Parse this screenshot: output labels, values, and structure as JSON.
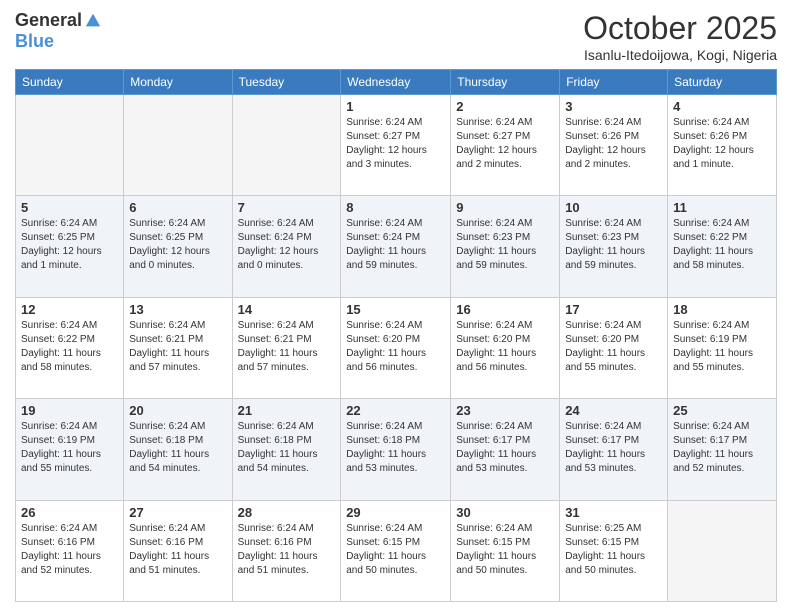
{
  "logo": {
    "general": "General",
    "blue": "Blue"
  },
  "title": "October 2025",
  "location": "Isanlu-Itedoijowa, Kogi, Nigeria",
  "days_of_week": [
    "Sunday",
    "Monday",
    "Tuesday",
    "Wednesday",
    "Thursday",
    "Friday",
    "Saturday"
  ],
  "weeks": [
    [
      {
        "day": "",
        "content": ""
      },
      {
        "day": "",
        "content": ""
      },
      {
        "day": "",
        "content": ""
      },
      {
        "day": "1",
        "content": "Sunrise: 6:24 AM\nSunset: 6:27 PM\nDaylight: 12 hours and 3 minutes."
      },
      {
        "day": "2",
        "content": "Sunrise: 6:24 AM\nSunset: 6:27 PM\nDaylight: 12 hours and 2 minutes."
      },
      {
        "day": "3",
        "content": "Sunrise: 6:24 AM\nSunset: 6:26 PM\nDaylight: 12 hours and 2 minutes."
      },
      {
        "day": "4",
        "content": "Sunrise: 6:24 AM\nSunset: 6:26 PM\nDaylight: 12 hours and 1 minute."
      }
    ],
    [
      {
        "day": "5",
        "content": "Sunrise: 6:24 AM\nSunset: 6:25 PM\nDaylight: 12 hours and 1 minute."
      },
      {
        "day": "6",
        "content": "Sunrise: 6:24 AM\nSunset: 6:25 PM\nDaylight: 12 hours and 0 minutes."
      },
      {
        "day": "7",
        "content": "Sunrise: 6:24 AM\nSunset: 6:24 PM\nDaylight: 12 hours and 0 minutes."
      },
      {
        "day": "8",
        "content": "Sunrise: 6:24 AM\nSunset: 6:24 PM\nDaylight: 11 hours and 59 minutes."
      },
      {
        "day": "9",
        "content": "Sunrise: 6:24 AM\nSunset: 6:23 PM\nDaylight: 11 hours and 59 minutes."
      },
      {
        "day": "10",
        "content": "Sunrise: 6:24 AM\nSunset: 6:23 PM\nDaylight: 11 hours and 59 minutes."
      },
      {
        "day": "11",
        "content": "Sunrise: 6:24 AM\nSunset: 6:22 PM\nDaylight: 11 hours and 58 minutes."
      }
    ],
    [
      {
        "day": "12",
        "content": "Sunrise: 6:24 AM\nSunset: 6:22 PM\nDaylight: 11 hours and 58 minutes."
      },
      {
        "day": "13",
        "content": "Sunrise: 6:24 AM\nSunset: 6:21 PM\nDaylight: 11 hours and 57 minutes."
      },
      {
        "day": "14",
        "content": "Sunrise: 6:24 AM\nSunset: 6:21 PM\nDaylight: 11 hours and 57 minutes."
      },
      {
        "day": "15",
        "content": "Sunrise: 6:24 AM\nSunset: 6:20 PM\nDaylight: 11 hours and 56 minutes."
      },
      {
        "day": "16",
        "content": "Sunrise: 6:24 AM\nSunset: 6:20 PM\nDaylight: 11 hours and 56 minutes."
      },
      {
        "day": "17",
        "content": "Sunrise: 6:24 AM\nSunset: 6:20 PM\nDaylight: 11 hours and 55 minutes."
      },
      {
        "day": "18",
        "content": "Sunrise: 6:24 AM\nSunset: 6:19 PM\nDaylight: 11 hours and 55 minutes."
      }
    ],
    [
      {
        "day": "19",
        "content": "Sunrise: 6:24 AM\nSunset: 6:19 PM\nDaylight: 11 hours and 55 minutes."
      },
      {
        "day": "20",
        "content": "Sunrise: 6:24 AM\nSunset: 6:18 PM\nDaylight: 11 hours and 54 minutes."
      },
      {
        "day": "21",
        "content": "Sunrise: 6:24 AM\nSunset: 6:18 PM\nDaylight: 11 hours and 54 minutes."
      },
      {
        "day": "22",
        "content": "Sunrise: 6:24 AM\nSunset: 6:18 PM\nDaylight: 11 hours and 53 minutes."
      },
      {
        "day": "23",
        "content": "Sunrise: 6:24 AM\nSunset: 6:17 PM\nDaylight: 11 hours and 53 minutes."
      },
      {
        "day": "24",
        "content": "Sunrise: 6:24 AM\nSunset: 6:17 PM\nDaylight: 11 hours and 53 minutes."
      },
      {
        "day": "25",
        "content": "Sunrise: 6:24 AM\nSunset: 6:17 PM\nDaylight: 11 hours and 52 minutes."
      }
    ],
    [
      {
        "day": "26",
        "content": "Sunrise: 6:24 AM\nSunset: 6:16 PM\nDaylight: 11 hours and 52 minutes."
      },
      {
        "day": "27",
        "content": "Sunrise: 6:24 AM\nSunset: 6:16 PM\nDaylight: 11 hours and 51 minutes."
      },
      {
        "day": "28",
        "content": "Sunrise: 6:24 AM\nSunset: 6:16 PM\nDaylight: 11 hours and 51 minutes."
      },
      {
        "day": "29",
        "content": "Sunrise: 6:24 AM\nSunset: 6:15 PM\nDaylight: 11 hours and 50 minutes."
      },
      {
        "day": "30",
        "content": "Sunrise: 6:24 AM\nSunset: 6:15 PM\nDaylight: 11 hours and 50 minutes."
      },
      {
        "day": "31",
        "content": "Sunrise: 6:25 AM\nSunset: 6:15 PM\nDaylight: 11 hours and 50 minutes."
      },
      {
        "day": "",
        "content": ""
      }
    ]
  ]
}
